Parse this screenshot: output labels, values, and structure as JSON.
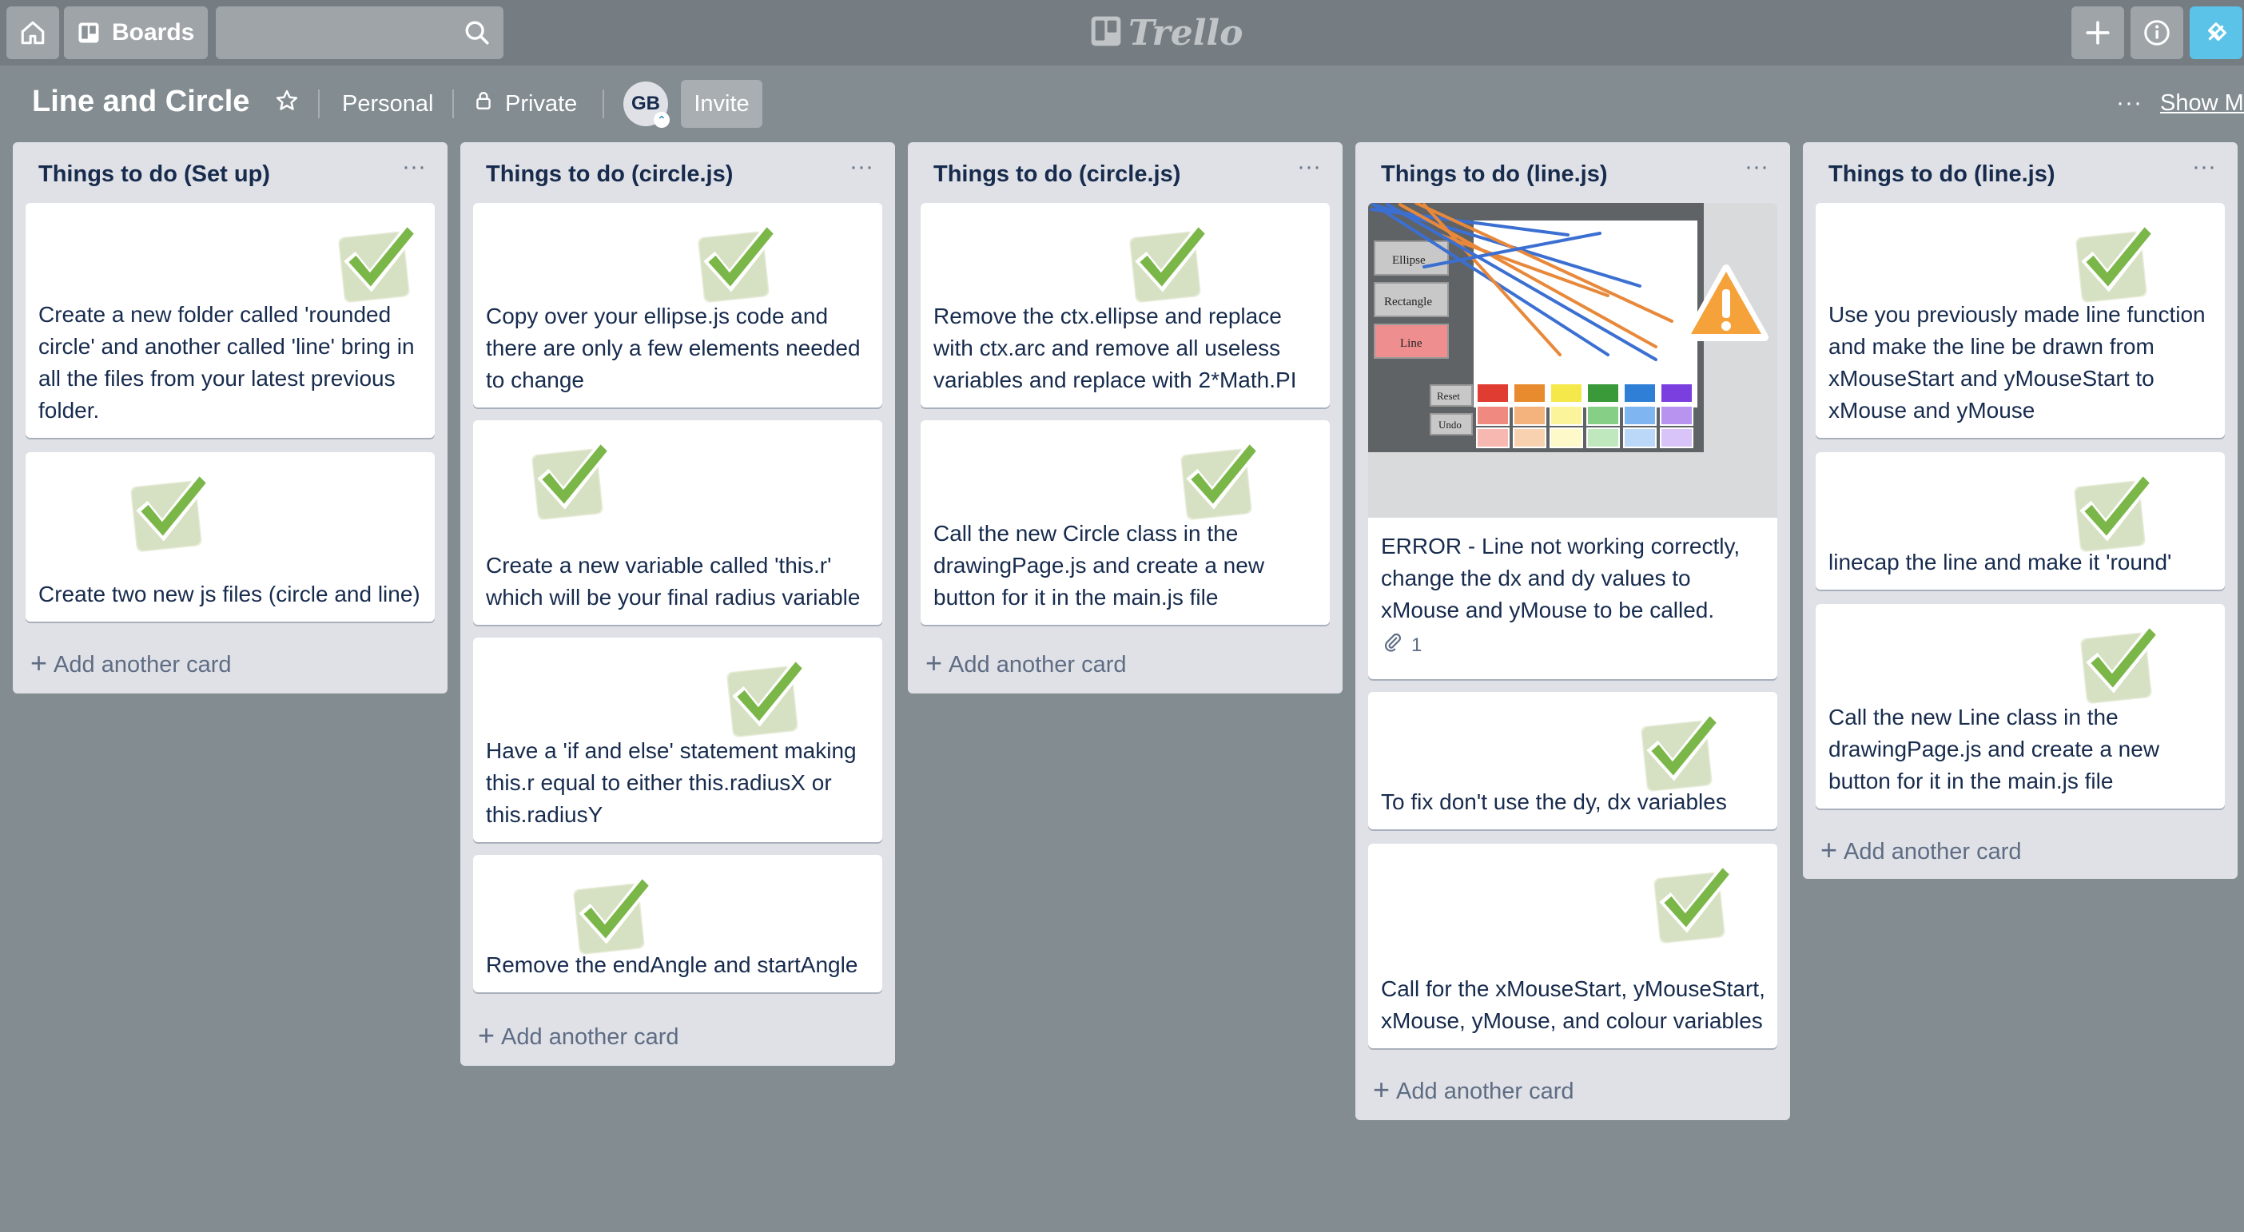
{
  "header": {
    "boards_label": "Boards",
    "search": {
      "value": "",
      "placeholder": ""
    },
    "logo_text": "Trello"
  },
  "board": {
    "title": "Line and Circle",
    "team": "Personal",
    "visibility": "Private",
    "avatar_initials": "GB",
    "invite_label": "Invite",
    "show_menu_label": "Show Me"
  },
  "colors": {
    "board_background": "#838c91",
    "header_background": "#757d82",
    "list_background": "#dfe1e6",
    "accent_button": "#5bc3e8",
    "check_green": "#7ab648"
  },
  "add_card_label": "Add another card",
  "lists": [
    {
      "title": "Things to do (Set up)",
      "cards": [
        {
          "text": "Create a new folder called 'rounded circle' and another called 'line' bring in all the files from your latest previous folder."
        },
        {
          "text": "Create two new js files (circle and line)"
        }
      ]
    },
    {
      "title": "Things to do (circle.js)",
      "cards": [
        {
          "text": "Copy over your ellipse.js code and there are only a few elements needed to change"
        },
        {
          "text": "Create a new variable called 'this.r' which will be your final radius variable"
        },
        {
          "text": "Have a 'if and else' statement making this.r equal to either this.radiusX or this.radiusY"
        },
        {
          "text": "Remove the endAngle and startAngle"
        }
      ]
    },
    {
      "title": "Things to do (circle.js)",
      "cards": [
        {
          "text": "Remove the ctx.ellipse and replace with ctx.arc and remove all useless variables and replace with 2*Math.PI"
        },
        {
          "text": "Call the new Circle class in the drawingPage.js and create a new button for it in the main.js file"
        }
      ]
    },
    {
      "title": "Things to do (line.js)",
      "cards": [
        {
          "text": "ERROR - Line not working correctly, change the dx and dy values to xMouse and yMouse to be called.",
          "attachments": "1",
          "cover": {
            "buttons": [
              "Ellipse",
              "Rectangle",
              "Line",
              "Reset",
              "Undo"
            ],
            "palette": [
              "#e03c31",
              "#e88b2e",
              "#f5e84a",
              "#3a9a3a",
              "#2f7fd6",
              "#7b3fe0",
              "#f08a80",
              "#f4b27d",
              "#fbf49a",
              "#86cf86",
              "#7fb5f0",
              "#b893f0",
              "#f7b8b2",
              "#f8d2b0",
              "#fdf9c8",
              "#bfe8bf",
              "#bcd8f8",
              "#d8c4f8"
            ]
          }
        },
        {
          "text": "To fix don't use the dy, dx variables"
        },
        {
          "text": "Call for the xMouseStart, yMouseStart, xMouse, yMouse, and colour variables"
        }
      ]
    },
    {
      "title": "Things to do (line.js)",
      "cards": [
        {
          "text": "Use you previously made line function and make the line be drawn from xMouseStart and yMouseStart to xMouse and yMouse"
        },
        {
          "text": "linecap the line and make it 'round'"
        },
        {
          "text": "Call the new Line class in the drawingPage.js and create a new button for it in the main.js file"
        }
      ]
    }
  ]
}
